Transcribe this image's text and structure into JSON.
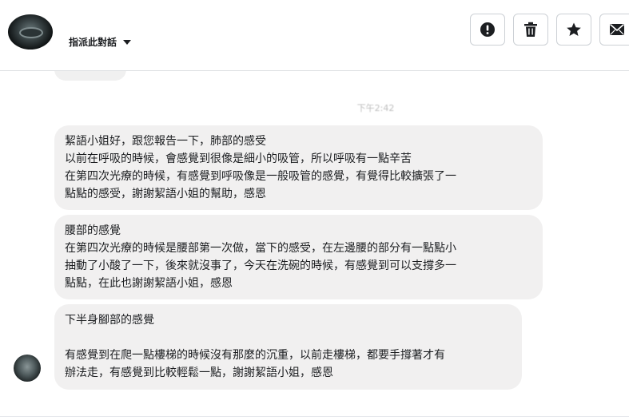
{
  "header": {
    "assign_label": "指派此對話"
  },
  "toolbar": {
    "buttons": [
      {
        "icon": "alert-icon"
      },
      {
        "icon": "trash-icon"
      },
      {
        "icon": "star-icon"
      },
      {
        "icon": "mail-icon"
      }
    ]
  },
  "chat": {
    "timestamp": "下午2:42",
    "messages": [
      {
        "lines": [
          "絜語小姐好，跟您報告一下，肺部的感受",
          "以前在呼吸的時候，會感覺到很像是細小的吸管，所以呼吸有一點辛苦",
          "在第四次光療的時候，有感覺到呼吸像是一般吸管的感覺，有覺得比較擴張了一",
          "點點的感受，謝謝絜語小姐的幫助，感恩"
        ]
      },
      {
        "lines": [
          "腰部的感覺",
          "在第四次光療的時候是腰部第一次做，當下的感受，在左邊腰的部分有一點點小",
          "抽動了小酸了一下，後來就沒事了，今天在洗碗的時候，有感覺到可以支撐多一",
          "點點，在此也謝謝絜語小姐，感恩"
        ]
      },
      {
        "lines": [
          "下半身腳部的感覺",
          "",
          "有感覺到在爬一點樓梯的時候沒有那麼的沉重，以前走樓梯，都要手撐著才有",
          "辦法走，有感覺到比較輕鬆一點，謝謝絜語小姐，感恩"
        ]
      }
    ]
  }
}
